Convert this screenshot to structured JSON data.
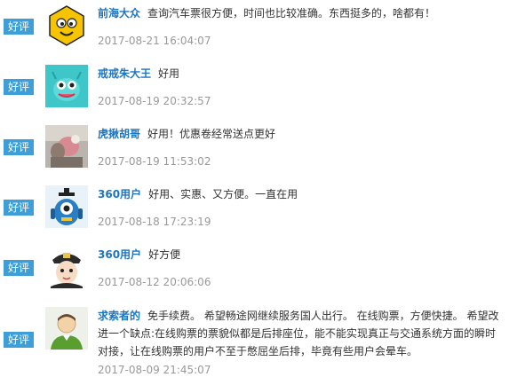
{
  "reviews": [
    {
      "badge": "好评",
      "avatar_icon": "smiley-hexagon-avatar-icon",
      "name": "前海大众",
      "comment": "查询汽车票很方便，时间也比较准确。东西挺多的，啥都有！",
      "date": "2017-08-21 16:04:07"
    },
    {
      "badge": "好评",
      "avatar_icon": "teal-monster-avatar-icon",
      "name": "戒戒朱大王",
      "comment": "好用",
      "date": "2017-08-19 20:32:57"
    },
    {
      "badge": "好评",
      "avatar_icon": "photo-avatar-icon",
      "name": "虎揪胡哥",
      "comment": "好用！优惠卷经常送点更好",
      "date": "2017-08-19 11:53:02"
    },
    {
      "badge": "好评",
      "avatar_icon": "blue-robot-avatar-icon",
      "name": "360用户",
      "comment": "好用、实惠、又方便。一直在用",
      "date": "2017-08-18 17:23:19"
    },
    {
      "badge": "好评",
      "avatar_icon": "police-cartoon-avatar-icon",
      "name": "360用户",
      "comment": "好方便",
      "date": "2017-08-12 20:06:06"
    },
    {
      "badge": "好评",
      "avatar_icon": "default-user-avatar-icon",
      "name": "求索者的",
      "comment": "免手续费。 希望畅途网继续服务国人出行。 在线购票，方便快捷。 希望改进一个缺点:在线购票的票貌似都是后排座位，能不能实现真正与交通系统方面的瞬时对接，让在线购票的用户不至于憋屈坐后排，毕竟有些用户会晕车。",
      "date": "2017-08-09 21:45:07"
    }
  ],
  "colors": {
    "badge_bg": "#3d9ed8",
    "name": "#1a76c4",
    "date": "#999999",
    "text": "#333333"
  }
}
